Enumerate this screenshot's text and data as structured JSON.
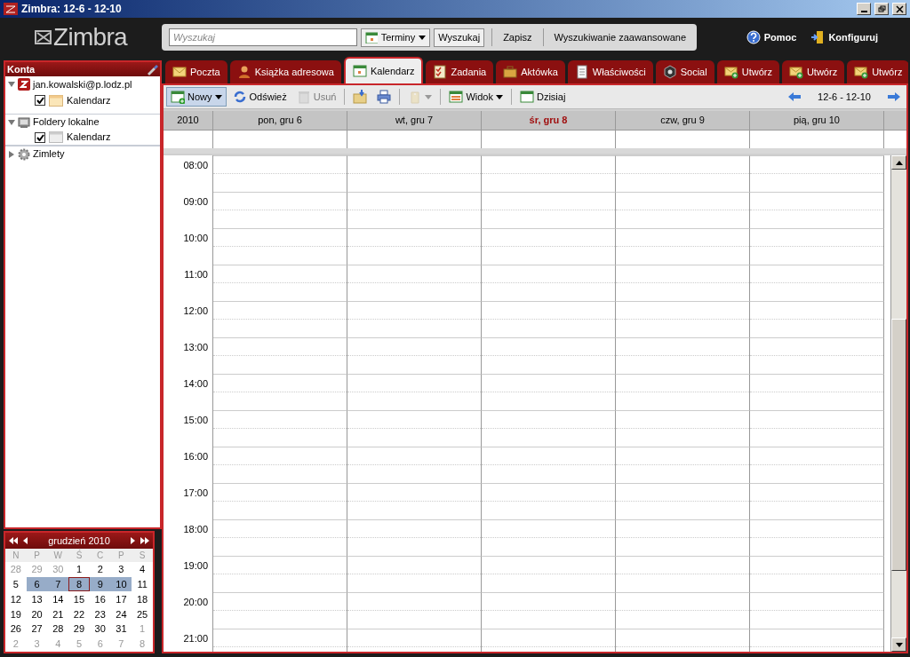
{
  "window": {
    "title": "Zimbra: 12-6 - 12-10"
  },
  "header": {
    "logo": "Zimbra",
    "search": {
      "placeholder": "Wyszukaj"
    },
    "search_type": "Terminy",
    "search_button": "Wyszukaj",
    "save": "Zapisz",
    "advanced": "Wyszukiwanie zaawansowane",
    "help": "Pomoc",
    "settings": "Konfiguruj"
  },
  "tabs": [
    {
      "label": "Poczta",
      "kind": "mail",
      "selected": false
    },
    {
      "label": "Książka adresowa",
      "kind": "person",
      "selected": false
    },
    {
      "label": "Kalendarz",
      "kind": "calendar",
      "selected": true
    },
    {
      "label": "Zadania",
      "kind": "tasks",
      "selected": false
    },
    {
      "label": "Aktówka",
      "kind": "briefcase",
      "selected": false
    },
    {
      "label": "Właściwości",
      "kind": "document",
      "selected": false
    },
    {
      "label": "Social",
      "kind": "social",
      "selected": false
    },
    {
      "label": "Utwórz",
      "kind": "compose",
      "selected": false
    },
    {
      "label": "Utwórz",
      "kind": "compose",
      "selected": false
    },
    {
      "label": "Utwórz",
      "kind": "compose",
      "selected": false
    }
  ],
  "sidebar": {
    "title": "Konta",
    "items": [
      {
        "label": "jan.kowalski@p.lodz.pl",
        "kind": "account",
        "expanded": true,
        "children": [
          {
            "label": "Kalendarz",
            "checked": true
          }
        ]
      },
      {
        "label": "Foldery lokalne",
        "kind": "local",
        "expanded": true,
        "children": [
          {
            "label": "Kalendarz",
            "checked": true
          }
        ]
      },
      {
        "label": "Zimlety",
        "kind": "zimlets",
        "expanded": false
      }
    ]
  },
  "mini_calendar": {
    "month": "grudzień 2010",
    "weekdays": [
      "N",
      "P",
      "W",
      "Ś",
      "C",
      "P",
      "S"
    ],
    "weeks": [
      [
        {
          "d": "28",
          "muted": true
        },
        {
          "d": "29",
          "muted": true
        },
        {
          "d": "30",
          "muted": true
        },
        {
          "d": "1"
        },
        {
          "d": "2"
        },
        {
          "d": "3"
        },
        {
          "d": "4"
        }
      ],
      [
        {
          "d": "5"
        },
        {
          "d": "6",
          "selected": true
        },
        {
          "d": "7",
          "selected": true
        },
        {
          "d": "8",
          "selected": true,
          "today": true
        },
        {
          "d": "9",
          "selected": true
        },
        {
          "d": "10",
          "selected": true
        },
        {
          "d": "11"
        }
      ],
      [
        {
          "d": "12"
        },
        {
          "d": "13"
        },
        {
          "d": "14"
        },
        {
          "d": "15"
        },
        {
          "d": "16"
        },
        {
          "d": "17"
        },
        {
          "d": "18"
        }
      ],
      [
        {
          "d": "19"
        },
        {
          "d": "20"
        },
        {
          "d": "21"
        },
        {
          "d": "22"
        },
        {
          "d": "23"
        },
        {
          "d": "24"
        },
        {
          "d": "25"
        }
      ],
      [
        {
          "d": "26"
        },
        {
          "d": "27"
        },
        {
          "d": "28"
        },
        {
          "d": "29"
        },
        {
          "d": "30"
        },
        {
          "d": "31"
        },
        {
          "d": "1",
          "muted": true
        }
      ],
      [
        {
          "d": "2",
          "muted": true
        },
        {
          "d": "3",
          "muted": true
        },
        {
          "d": "4",
          "muted": true
        },
        {
          "d": "5",
          "muted": true
        },
        {
          "d": "6",
          "muted": true
        },
        {
          "d": "7",
          "muted": true
        },
        {
          "d": "8",
          "muted": true
        }
      ]
    ]
  },
  "toolbar": {
    "buttons": [
      {
        "label": "Nowy",
        "kind": "new",
        "dropdown": true,
        "disabled": false
      },
      {
        "label": "Odśwież",
        "kind": "refresh",
        "dropdown": false,
        "disabled": false
      },
      {
        "label": "Usuń",
        "kind": "delete",
        "dropdown": false,
        "disabled": true
      },
      {
        "kind": "move",
        "dropdown": false,
        "disabled": false
      },
      {
        "kind": "print",
        "dropdown": false,
        "disabled": false
      },
      {
        "kind": "tag",
        "dropdown": true,
        "disabled": true
      },
      {
        "label": "Widok",
        "kind": "view",
        "dropdown": true,
        "disabled": false
      },
      {
        "label": "Dzisiaj",
        "kind": "today",
        "dropdown": false,
        "disabled": false
      }
    ],
    "range": "12-6 - 12-10"
  },
  "week_view": {
    "year": "2010",
    "days": [
      {
        "label": "pon, gru 6",
        "today": false
      },
      {
        "label": "wt, gru 7",
        "today": false
      },
      {
        "label": "śr, gru 8",
        "today": true
      },
      {
        "label": "czw, gru 9",
        "today": false
      },
      {
        "label": "pią, gru 10",
        "today": false
      }
    ],
    "hours": [
      "08:00",
      "09:00",
      "10:00",
      "11:00",
      "12:00",
      "13:00",
      "14:00",
      "15:00",
      "16:00",
      "17:00",
      "18:00",
      "19:00",
      "20:00",
      "21:00"
    ]
  }
}
